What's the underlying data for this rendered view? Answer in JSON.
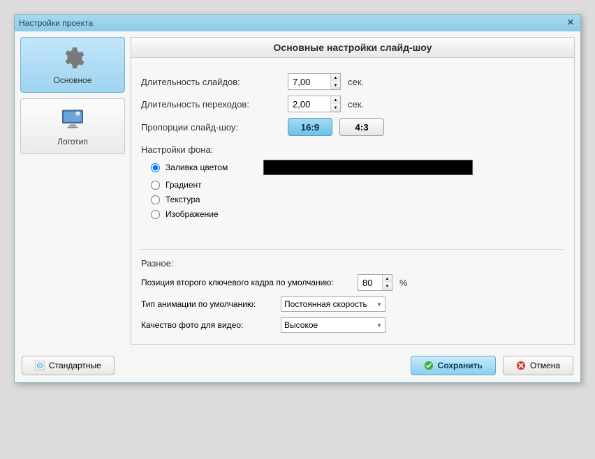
{
  "window": {
    "title": "Настройки проекта"
  },
  "sidebar": {
    "items": [
      {
        "label": "Основное"
      },
      {
        "label": "Логотип"
      }
    ]
  },
  "panel": {
    "title": "Основные настройки слайд-шоу"
  },
  "slides": {
    "duration_label": "Длительность слайдов:",
    "duration_value": "7,00",
    "duration_unit": "сек.",
    "transition_label": "Длительность переходов:",
    "transition_value": "2,00",
    "transition_unit": "сек.",
    "ratio_label": "Пропорции слайд-шоу:",
    "ratio_16_9": "16:9",
    "ratio_4_3": "4:3"
  },
  "background": {
    "section_label": "Настройки фона:",
    "options": [
      "Заливка цветом",
      "Градиент",
      "Текстура",
      "Изображение"
    ],
    "selected_index": 0,
    "color_hex": "#000000"
  },
  "misc": {
    "section_label": "Разное:",
    "keyframe_label": "Позиция второго ключевого кадра по умолчанию:",
    "keyframe_value": "80",
    "keyframe_unit": "%",
    "anim_type_label": "Тип анимации по умолчанию:",
    "anim_type_value": "Постоянная скорость",
    "photo_quality_label": "Качество фото для видео:",
    "photo_quality_value": "Высокое"
  },
  "footer": {
    "defaults_label": "Стандартные",
    "save_label": "Сохранить",
    "cancel_label": "Отмена"
  }
}
